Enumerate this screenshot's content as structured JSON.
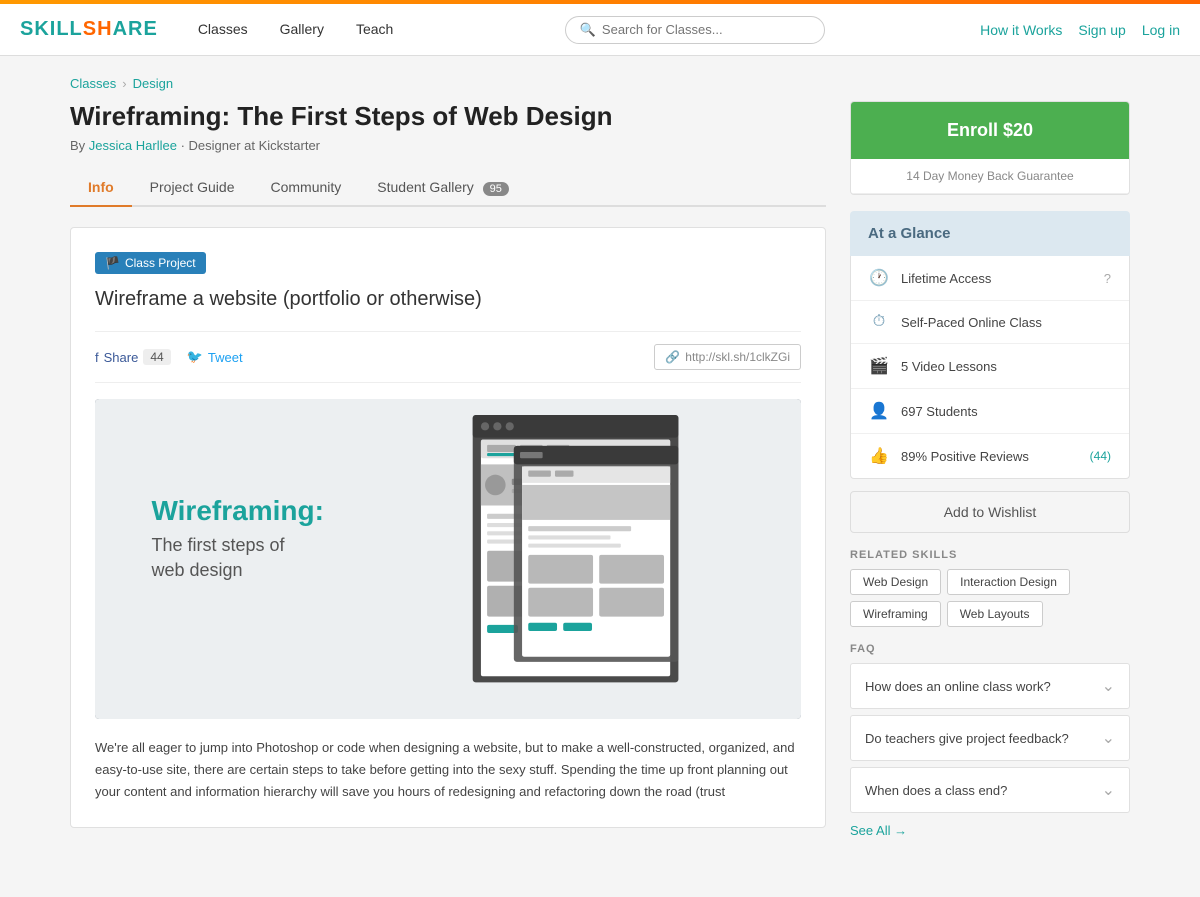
{
  "topbar": {
    "logo": {
      "sk": "SKILL",
      "share": "SHARE"
    }
  },
  "nav": {
    "classes_label": "Classes",
    "gallery_label": "Gallery",
    "teach_label": "Teach",
    "search_placeholder": "Search for Classes...",
    "how_it_works": "How it Works",
    "sign_up": "Sign up",
    "log_in": "Log in"
  },
  "breadcrumb": {
    "classes": "Classes",
    "separator": "›",
    "design": "Design"
  },
  "page": {
    "title": "Wireframing: The First Steps of Web Design",
    "author_prefix": "By",
    "author": "Jessica Harllee",
    "author_suffix": "· Designer at Kickstarter"
  },
  "tabs": [
    {
      "id": "info",
      "label": "Info",
      "active": true
    },
    {
      "id": "project-guide",
      "label": "Project Guide",
      "active": false
    },
    {
      "id": "community",
      "label": "Community",
      "active": false
    },
    {
      "id": "student-gallery",
      "label": "Student Gallery",
      "badge": "95",
      "active": false
    }
  ],
  "class_project": {
    "badge_label": "Class Project",
    "flag_icon": "🏴",
    "title": "Wireframe a website (portfolio or otherwise)"
  },
  "share": {
    "facebook_label": "Share",
    "facebook_count": "44",
    "twitter_label": "Tweet",
    "link_icon": "🔗",
    "link_url": "http://skl.sh/1clkZGi"
  },
  "wireframe_image": {
    "title_teal": "Wireframing:",
    "subtitle_line1": "The first steps of",
    "subtitle_line2": "web design"
  },
  "description": "We're all eager to jump into Photoshop or code when designing a website, but to make a well-constructed, organized, and easy-to-use site, there are certain steps to take before getting into the sexy stuff. Spending the time up front planning out your content and information hierarchy will save you hours of redesigning and refactoring down the road (trust",
  "enroll": {
    "button_label": "Enroll $20",
    "money_back": "14 Day Money Back Guarantee"
  },
  "at_a_glance": {
    "title": "At a Glance",
    "items": [
      {
        "icon": "🕐",
        "text": "Lifetime Access",
        "show_help": true
      },
      {
        "icon": "⏱",
        "text": "Self-Paced Online Class",
        "show_help": false
      },
      {
        "icon": "🎬",
        "text": "5 Video Lessons",
        "show_help": false
      },
      {
        "icon": "👤",
        "text": "697 Students",
        "show_help": false
      },
      {
        "icon": "👍",
        "text": "89% Positive Reviews",
        "show_help": false,
        "link_text": "(44)"
      }
    ]
  },
  "wishlist": {
    "button_label": "Add to Wishlist"
  },
  "related_skills": {
    "section_label": "RELATED SKILLS",
    "tags": [
      "Web Design",
      "Interaction Design",
      "Wireframing",
      "Web Layouts"
    ]
  },
  "faq": {
    "section_label": "FAQ",
    "items": [
      {
        "question": "How does an online class work?"
      },
      {
        "question": "Do teachers give project feedback?"
      },
      {
        "question": "When does a class end?"
      }
    ],
    "see_all_label": "See All →"
  }
}
